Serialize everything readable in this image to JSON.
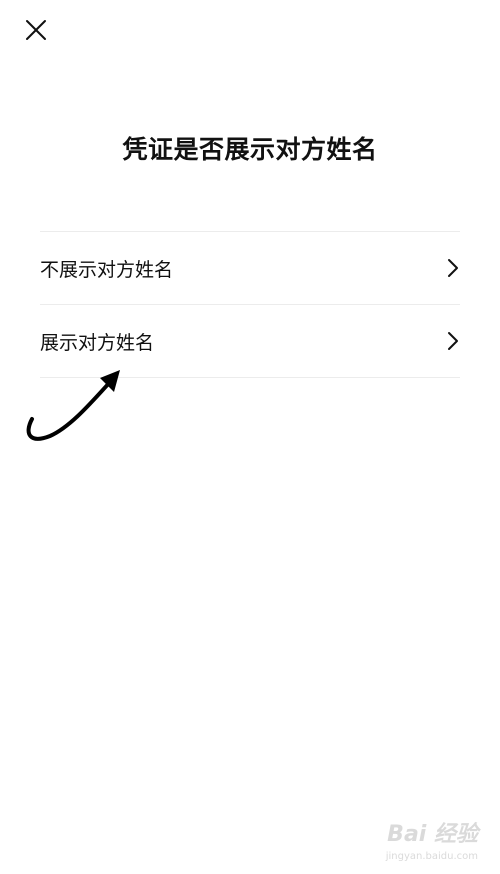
{
  "header": {
    "close_icon": "close-icon"
  },
  "page": {
    "title": "凭证是否展示对方姓名"
  },
  "options": [
    {
      "label": "不展示对方姓名",
      "icon": "chevron-right-icon"
    },
    {
      "label": "展示对方姓名",
      "icon": "chevron-right-icon"
    }
  ],
  "annotation": {
    "icon": "curved-arrow-icon",
    "color": "#000000"
  },
  "watermark": {
    "main": "Bai 经验",
    "sub": "jingyan.baidu.com"
  },
  "colors": {
    "background": "#ffffff",
    "text": "#111111",
    "divider": "#ececec"
  }
}
